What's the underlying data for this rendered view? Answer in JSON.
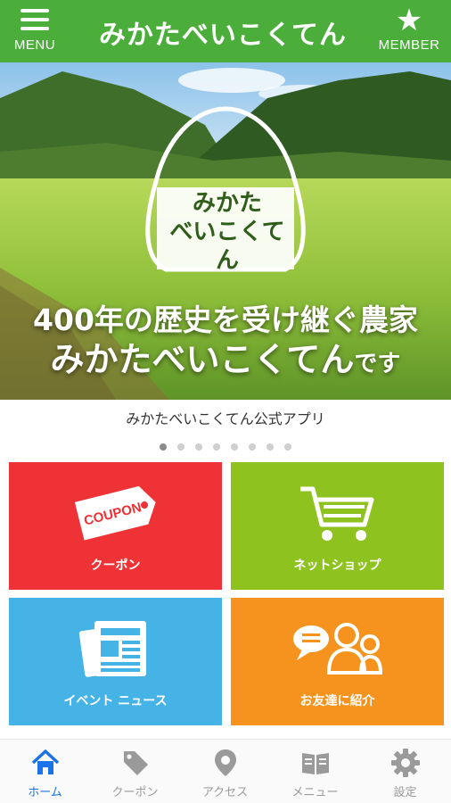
{
  "header": {
    "menu_label": "MENU",
    "logo_text": "みかたべいこくてん",
    "member_label": "MEMBER",
    "bg_color": "#4cae3a"
  },
  "hero": {
    "badge_line1": "みかた",
    "badge_line2": "べいこくてん",
    "headline1": "400年の歴史を受け継ぐ農家",
    "headline2_main": "みかたべいこくてん",
    "headline2_suffix": "です"
  },
  "carousel": {
    "caption": "みかたべいこくてん公式アプリ",
    "page_count": 8,
    "active_index": 0
  },
  "tiles": {
    "coupon": {
      "label": "クーポン",
      "icon_text": "COUPON",
      "color": "#ee3236"
    },
    "shop": {
      "label": "ネットショップ",
      "color": "#8ec21f"
    },
    "news": {
      "label": "イベント ニュース",
      "color": "#46b3e6"
    },
    "friend": {
      "label": "お友達に紹介",
      "color": "#f5931e"
    }
  },
  "bottom_nav": {
    "items": [
      {
        "label": "ホーム",
        "icon": "home-icon",
        "active": true
      },
      {
        "label": "クーポン",
        "icon": "tag-icon",
        "active": false
      },
      {
        "label": "アクセス",
        "icon": "map-pin-icon",
        "active": false
      },
      {
        "label": "メニュー",
        "icon": "book-icon",
        "active": false
      },
      {
        "label": "設定",
        "icon": "gear-icon",
        "active": false
      }
    ],
    "active_color": "#1a73e8"
  }
}
